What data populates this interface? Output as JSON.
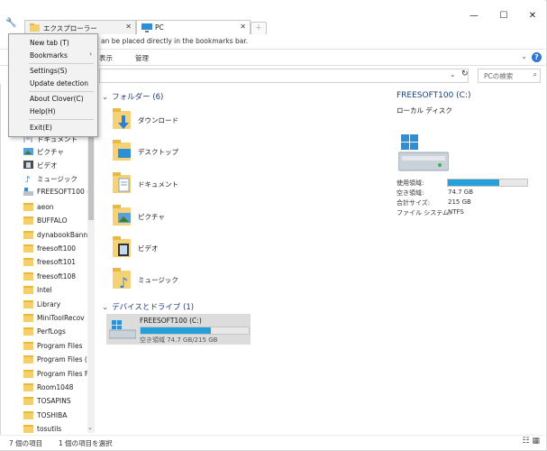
{
  "tabs": [
    {
      "label": "エクスプローラー",
      "active": false
    },
    {
      "label": "PC",
      "active": true
    }
  ],
  "window_controls": {
    "minimize": "—",
    "maximize": "☐",
    "close": "✕"
  },
  "bookmarks_bar": {
    "hint": "an be placed directly in the bookmarks bar."
  },
  "ribbon": {
    "view_tab": "表示",
    "manage_tab": "管理"
  },
  "search": {
    "placeholder": "PCの検索"
  },
  "menu": {
    "items": [
      {
        "label": "New tab (T)"
      },
      {
        "label": "Bookmarks",
        "submenu": true
      },
      {
        "label": "Settings(S)"
      },
      {
        "label": "Update detection"
      },
      {
        "label": "About Clover(C)"
      },
      {
        "label": "Help(H)"
      },
      {
        "label": "Exit(E)"
      }
    ]
  },
  "nav": {
    "items": [
      {
        "label": "ドキュメント",
        "icon": "documents-icon"
      },
      {
        "label": "ピクチャ",
        "icon": "pictures-icon"
      },
      {
        "label": "ビデオ",
        "icon": "videos-icon"
      },
      {
        "label": "ミュージック",
        "icon": "music-icon"
      },
      {
        "label": "FREESOFT100 (C:",
        "icon": "drive-icon"
      },
      {
        "label": "aeon",
        "icon": "folder-icon"
      },
      {
        "label": "BUFFALO",
        "icon": "folder-icon"
      },
      {
        "label": "dynabookBann",
        "icon": "folder-icon"
      },
      {
        "label": "freesoft100",
        "icon": "folder-icon"
      },
      {
        "label": "freesoft101",
        "icon": "folder-icon"
      },
      {
        "label": "freesoft108",
        "icon": "folder-icon"
      },
      {
        "label": "Intel",
        "icon": "folder-icon"
      },
      {
        "label": "Library",
        "icon": "folder-icon"
      },
      {
        "label": "MiniToolRecov",
        "icon": "folder-icon"
      },
      {
        "label": "PerfLogs",
        "icon": "folder-icon"
      },
      {
        "label": "Program Files",
        "icon": "folder-icon"
      },
      {
        "label": "Program Files (",
        "icon": "folder-icon"
      },
      {
        "label": "Program Files F",
        "icon": "folder-icon"
      },
      {
        "label": "Room1048",
        "icon": "folder-icon"
      },
      {
        "label": "TOSAPINS",
        "icon": "folder-icon"
      },
      {
        "label": "TOSHIBA",
        "icon": "folder-icon"
      },
      {
        "label": "tosutils",
        "icon": "folder-icon"
      }
    ]
  },
  "main": {
    "folders_header": "フォルダー (6)",
    "folders": [
      {
        "label": "ダウンロード"
      },
      {
        "label": "デスクトップ"
      },
      {
        "label": "ドキュメント"
      },
      {
        "label": "ピクチャ"
      },
      {
        "label": "ビデオ"
      },
      {
        "label": "ミュージック"
      }
    ],
    "drives_header": "デバイスとドライブ (1)",
    "drive": {
      "name": "FREESOFT100 (C:)",
      "free_text": "空き領域 74.7 GB/215 GB",
      "used_fraction": 0.65
    }
  },
  "details": {
    "title": "FREESOFT100 (C:)",
    "type": "ローカル ディスク",
    "used_label": "使用領域:",
    "used_fraction": 0.65,
    "props": [
      {
        "key": "空き領域:",
        "value": "74.7 GB"
      },
      {
        "key": "合計サイズ:",
        "value": "215 GB"
      },
      {
        "key": "ファイル システム:",
        "value": "NTFS"
      }
    ]
  },
  "status": {
    "items_count": "7 個の項目",
    "selected": "1 個の項目を選択"
  },
  "colors": {
    "accent": "#26a0da",
    "folder": "#f5cf6a",
    "header_text": "#1e3f74"
  }
}
